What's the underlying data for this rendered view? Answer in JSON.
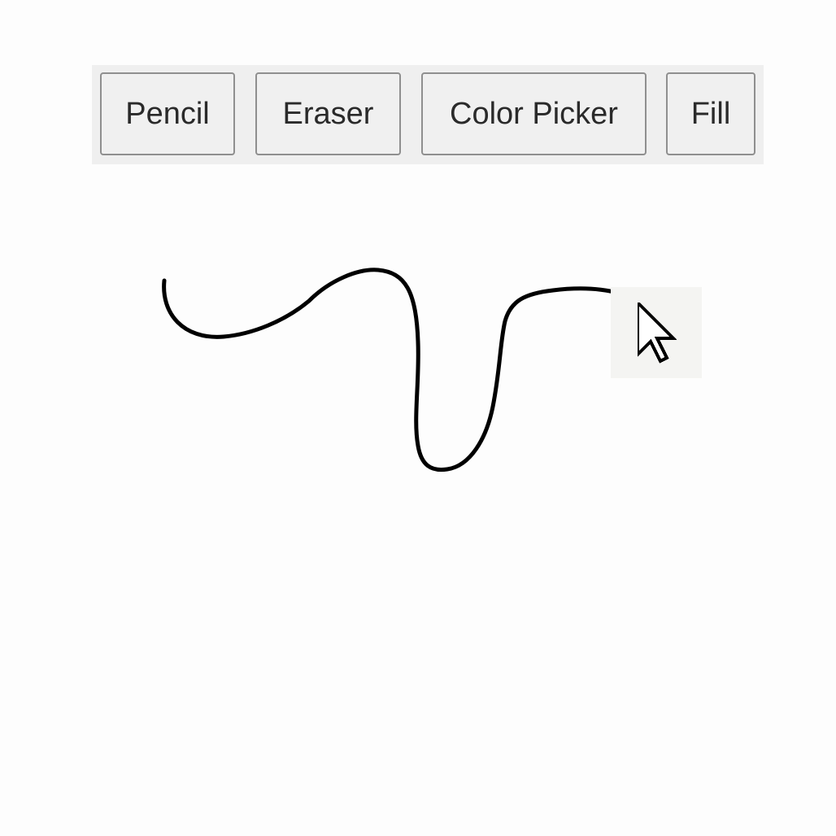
{
  "toolbar": {
    "pencil_label": "Pencil",
    "eraser_label": "Eraser",
    "color_picker_label": "Color Picker",
    "fill_label": "Fill"
  },
  "canvas": {
    "stroke_color": "#000000",
    "background_color": "#fdfdfd"
  },
  "cursor": {
    "icon": "arrow-pointer-icon"
  }
}
